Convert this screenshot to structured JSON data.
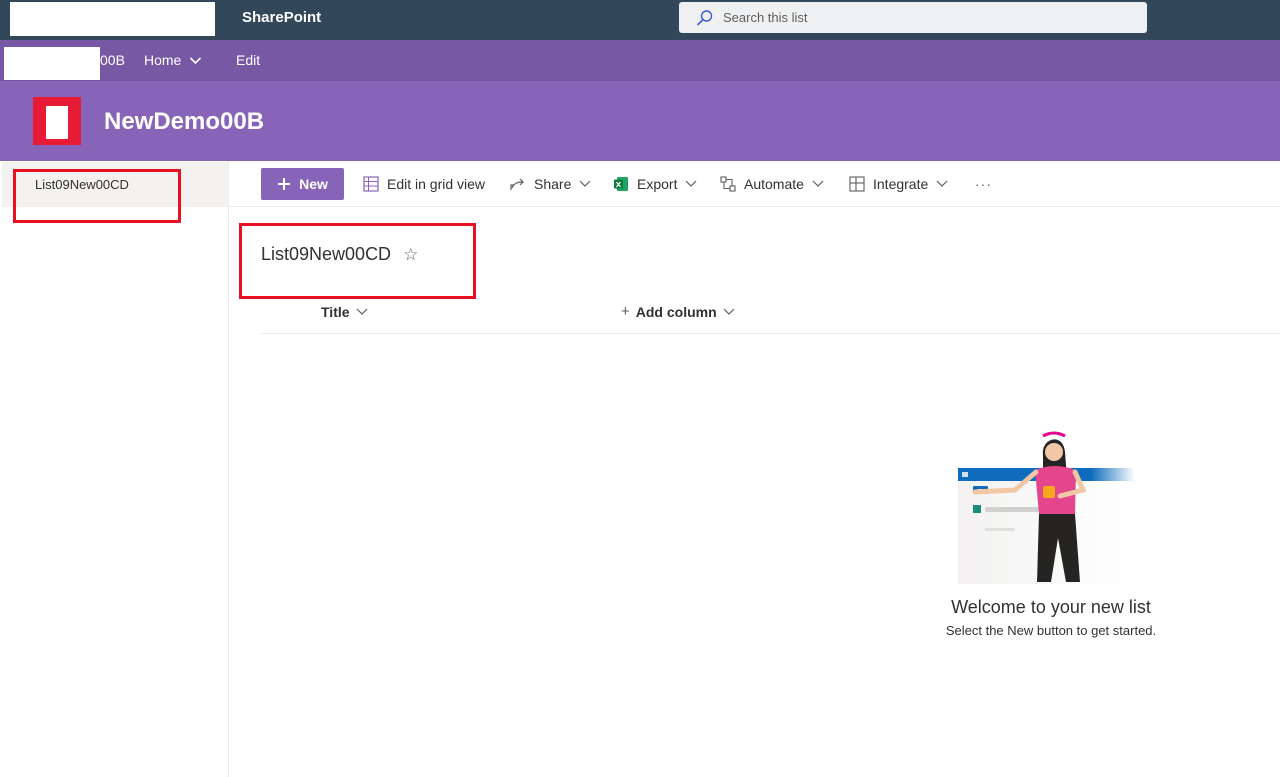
{
  "suite_bar": {
    "app_name": "SharePoint",
    "search_placeholder": "Search this list"
  },
  "hub_nav": {
    "site_code_fragment": "00B",
    "home_label": "Home",
    "edit_label": "Edit"
  },
  "site_header": {
    "title": "NewDemo00B"
  },
  "left_nav": {
    "items": [
      {
        "label": "List09New00CD"
      }
    ]
  },
  "command_bar": {
    "new_label": "New",
    "edit_grid_label": "Edit in grid view",
    "share_label": "Share",
    "export_label": "Export",
    "automate_label": "Automate",
    "integrate_label": "Integrate",
    "more_label": "···"
  },
  "list": {
    "title": "List09New00CD",
    "favorite_glyph": "☆",
    "columns": [
      {
        "label": "Title"
      }
    ],
    "add_column_label": "Add column"
  },
  "empty_state": {
    "heading": "Welcome to your new list",
    "subtext": "Select the New button to get started."
  },
  "colors": {
    "suite_bar": "#33475b",
    "hub_nav": "#7758a5",
    "site_header": "#8764b8",
    "accent": "#8764b8",
    "annotation": "#e81123"
  }
}
